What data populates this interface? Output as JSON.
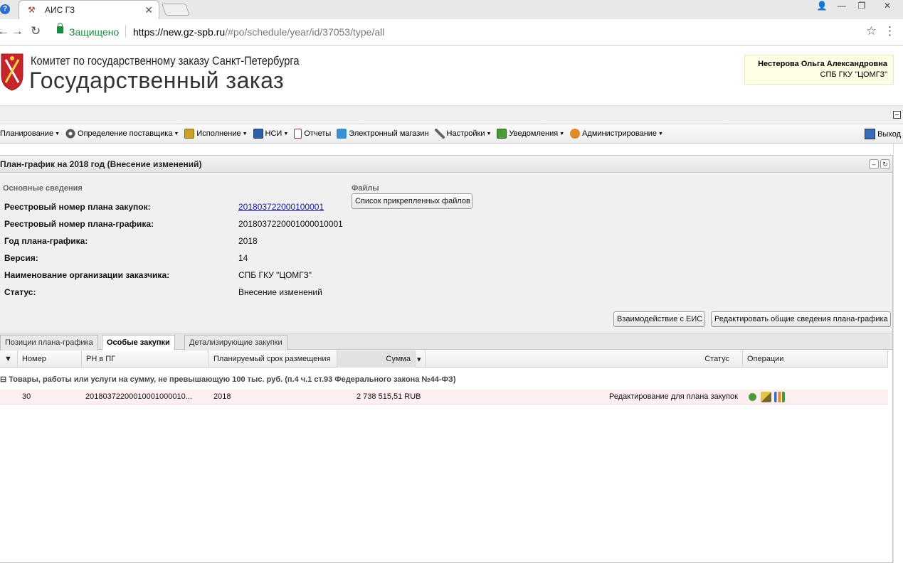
{
  "browser": {
    "tab_title": "АИС ГЗ",
    "secure_label": "Защищено",
    "url_host": "https://new.gz-spb.ru",
    "url_path": "/#po/schedule/year/id/37053/type/all"
  },
  "header": {
    "committee": "Комитет по государственному заказу Санкт-Петербурга",
    "title": "Государственный заказ",
    "user_name": "Нестерова Ольга Александровна",
    "user_org": "СПБ ГКУ \"ЦОМГЗ\""
  },
  "menu": {
    "items": [
      {
        "label": "Планирование",
        "icon": "planning-icon",
        "color": ""
      },
      {
        "label": "Определение поставщика",
        "icon": "gears-icon",
        "color": "#555555"
      },
      {
        "label": "Исполнение",
        "icon": "execution-icon",
        "color": "#c9a227"
      },
      {
        "label": "НСИ",
        "icon": "book-icon",
        "color": "#2f5fa8"
      },
      {
        "label": "Отчеты",
        "icon": "report-icon",
        "color": "#b03030"
      },
      {
        "label": "Электронный магазин",
        "icon": "cart-icon",
        "color": "#3a8ed6"
      },
      {
        "label": "Настройки",
        "icon": "wrench-icon",
        "color": "#666666"
      },
      {
        "label": "Уведомления",
        "icon": "notify-icon",
        "color": "#4a9a3a"
      },
      {
        "label": "Администрирование",
        "icon": "admin-icon",
        "color": "#e08a2a"
      }
    ],
    "exit_label": "Выход"
  },
  "panel": {
    "title": "План-график на 2018 год (Внесение изменений)",
    "main_section": "Основные сведения",
    "files_section": "Файлы",
    "files_button": "Список прикрепленных файлов",
    "fields": [
      {
        "label": "Реестровый номер плана закупок:",
        "value": "201803722000100001"
      },
      {
        "label": "Реестровый номер плана-графика:",
        "value": "2018037220001000010001"
      },
      {
        "label": "Год плана-графика:",
        "value": "2018"
      },
      {
        "label": "Версия:",
        "value": "14"
      },
      {
        "label": "Наименование организации заказчика:",
        "value": "СПБ ГКУ \"ЦОМГЗ\""
      },
      {
        "label": "Статус:",
        "value": "Внесение изменений"
      }
    ],
    "eis_button": "Взаимодействие с ЕИС",
    "edit_button": "Редактировать общие сведения плана-графика"
  },
  "tabs": [
    "Позиции плана-графика",
    "Особые закупки",
    "Детализирующие закупки"
  ],
  "grid": {
    "columns": [
      "Номер",
      "РН в ПГ",
      "Планируемый срок размещения",
      "Сумма",
      "Статус",
      "Операции"
    ],
    "group_label": "Товары, работы или услуги на сумму, не превышающую 100 тыс. руб. (п.4 ч.1 ст.93 Федерального закона №44-ФЗ)",
    "rows": [
      {
        "number": "30",
        "rn": "20180372200010001000010...",
        "term": "2018",
        "sum": "2 738 515,51 RUB",
        "status": "Редактирование для плана закупок"
      }
    ]
  }
}
